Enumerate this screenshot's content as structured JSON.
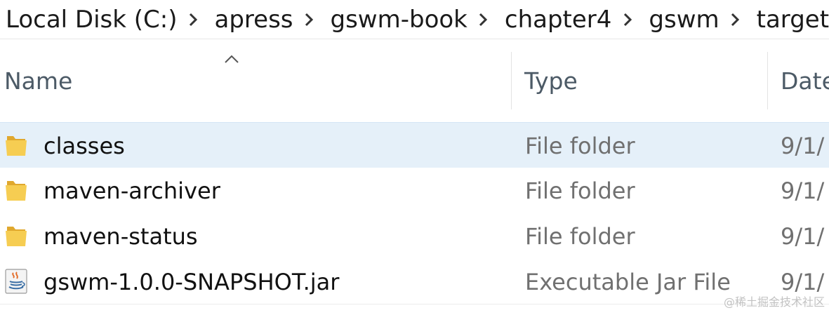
{
  "breadcrumb": {
    "items": [
      "Local Disk (C:)",
      "apress",
      "gswm-book",
      "chapter4",
      "gswm",
      "target"
    ]
  },
  "columns": {
    "name": "Name",
    "type": "Type",
    "date": "Date"
  },
  "sort": {
    "column": "name",
    "icon": "sort-ascending-icon"
  },
  "files": [
    {
      "name": "classes",
      "type": "File folder",
      "date": "9/1/",
      "icon": "folder-icon",
      "selected": true
    },
    {
      "name": "maven-archiver",
      "type": "File folder",
      "date": "9/1/",
      "icon": "folder-icon",
      "selected": false
    },
    {
      "name": "maven-status",
      "type": "File folder",
      "date": "9/1/",
      "icon": "folder-icon",
      "selected": false
    },
    {
      "name": "gswm-1.0.0-SNAPSHOT.jar",
      "type": "Executable Jar File",
      "date": "9/1/",
      "icon": "java-jar-icon",
      "selected": false
    }
  ],
  "watermark": "@稀土掘金技术社区",
  "colors": {
    "selection": "#e5f0f9",
    "folder": "#f3c84c",
    "header_text": "#4c5a66",
    "secondary_text": "#707070"
  }
}
